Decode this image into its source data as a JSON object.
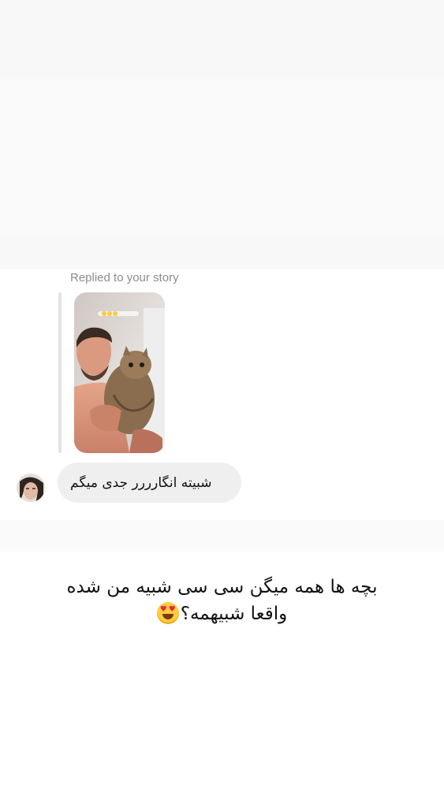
{
  "story_reply": {
    "label": "Replied to your story",
    "thumbnail_icon": "story-photo-thumbnail"
  },
  "message": {
    "text": "شبیته انگارررر جدی میگم",
    "avatar_icon": "user-avatar"
  },
  "caption": {
    "line1": "بچه ها همه میگن سی سی شبیه من شده",
    "line2": "واقعا شبیهمه؟",
    "emoji_icon": "heart-eyes-emoji"
  },
  "colors": {
    "bubble": "#efefef",
    "label": "#8a8d91",
    "text": "#111111"
  }
}
